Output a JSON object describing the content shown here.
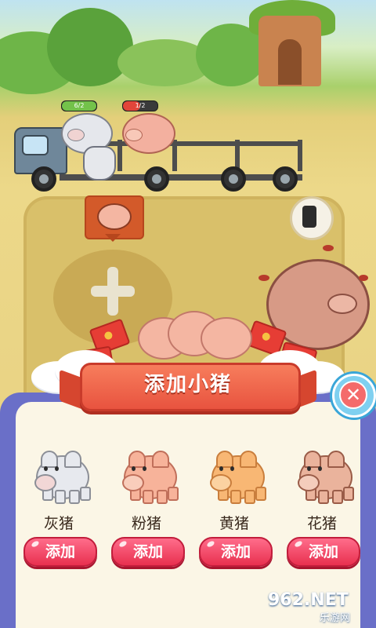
{
  "hud": {
    "pig1_level": "6/2",
    "pig2_level": "1/2"
  },
  "modal": {
    "title": "添加小猪",
    "close_symbol": "✕"
  },
  "options": [
    {
      "label": "灰猪",
      "button": "添加",
      "color": "#e7e9ee",
      "outline": "#8c8f97",
      "snout": "#f2d7d6"
    },
    {
      "label": "粉猪",
      "button": "添加",
      "color": "#f7b39a",
      "outline": "#c06f5a",
      "snout": "#f9cdbb"
    },
    {
      "label": "黄猪",
      "button": "添加",
      "color": "#f8b774",
      "outline": "#c97e3d",
      "snout": "#fbd2a1"
    },
    {
      "label": "花猪",
      "button": "添加",
      "color": "#eab39c",
      "outline": "#9a5c48",
      "snout": "#f4cdbc"
    }
  ],
  "watermark": {
    "logo": "962.NET",
    "sub": "乐游网"
  },
  "colors": {
    "modal_frame": "#6a6fc8",
    "button": "#e8304f",
    "ribbon": "#e8533f"
  }
}
